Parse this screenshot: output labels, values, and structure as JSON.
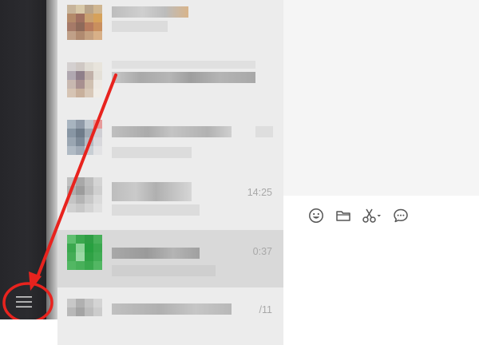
{
  "chat_list": {
    "rows": [
      {
        "time": ""
      },
      {
        "time": ""
      },
      {
        "time": ""
      },
      {
        "time": "14:25"
      },
      {
        "time": "0:37",
        "selected": true
      },
      {
        "time": "/11"
      }
    ]
  },
  "toolbar": {
    "icons": [
      "emoji-icon",
      "folder-icon",
      "scissors-icon",
      "chat-bubble-icon"
    ]
  },
  "colors": {
    "rail": "#2b2b2f",
    "list_bg": "#ececec",
    "selected_row": "#d9d9d9",
    "annotation": "#e8231e"
  }
}
